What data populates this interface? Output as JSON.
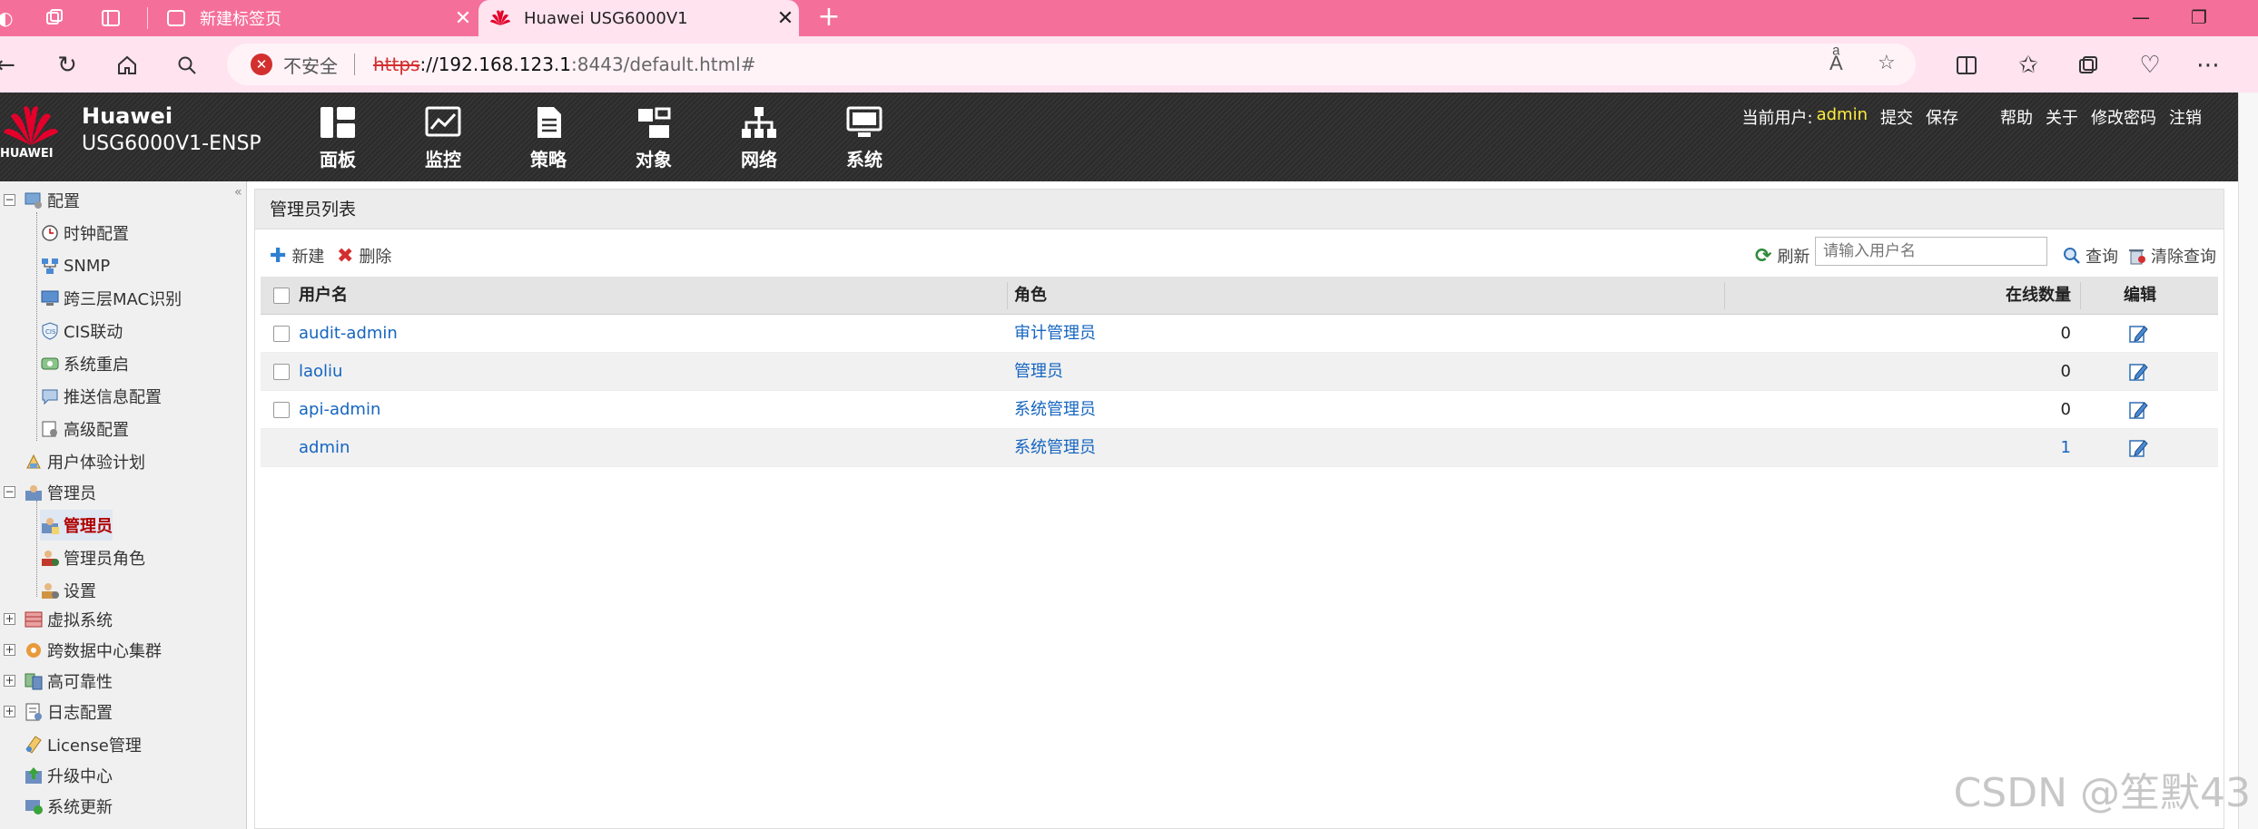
{
  "browser": {
    "tabs": [
      {
        "title": "新建标签页",
        "active": false
      },
      {
        "title": "Huawei USG6000V1",
        "active": true
      }
    ],
    "address": {
      "security_label": "不安全",
      "protocol": "https",
      "host": "://192.168.123.1",
      "rest": ":8443/default.html#"
    }
  },
  "app": {
    "logo_text": "HUAWEI",
    "brand": "Huawei",
    "device": "USG6000V1-ENSP",
    "nav": [
      {
        "label": "面板",
        "icon": "dashboard-icon"
      },
      {
        "label": "监控",
        "icon": "monitor-icon"
      },
      {
        "label": "策略",
        "icon": "policy-icon"
      },
      {
        "label": "对象",
        "icon": "object-icon"
      },
      {
        "label": "网络",
        "icon": "network-icon"
      },
      {
        "label": "系统",
        "icon": "system-icon"
      }
    ],
    "user_label": "当前用户:",
    "user_name": "admin",
    "actions": [
      "提交",
      "保存",
      "帮助",
      "关于",
      "修改密码",
      "注销"
    ]
  },
  "tree": {
    "items": [
      {
        "label": "配置",
        "level": 0,
        "expander": "−"
      },
      {
        "label": "时钟配置",
        "level": 1
      },
      {
        "label": "SNMP",
        "level": 1
      },
      {
        "label": "跨三层MAC识别",
        "level": 1
      },
      {
        "label": "CIS联动",
        "level": 1
      },
      {
        "label": "系统重启",
        "level": 1
      },
      {
        "label": "推送信息配置",
        "level": 1
      },
      {
        "label": "高级配置",
        "level": 1
      },
      {
        "label": "用户体验计划",
        "level": 0
      },
      {
        "label": "管理员",
        "level": 0,
        "expander": "−"
      },
      {
        "label": "管理员",
        "level": 1,
        "active": true
      },
      {
        "label": "管理员角色",
        "level": 1
      },
      {
        "label": "设置",
        "level": 1
      },
      {
        "label": "虚拟系统",
        "level": 0,
        "expander": "+"
      },
      {
        "label": "跨数据中心集群",
        "level": 0,
        "expander": "+"
      },
      {
        "label": "高可靠性",
        "level": 0,
        "expander": "+"
      },
      {
        "label": "日志配置",
        "level": 0,
        "expander": "+"
      },
      {
        "label": "License管理",
        "level": 0
      },
      {
        "label": "升级中心",
        "level": 0
      },
      {
        "label": "系统更新",
        "level": 0
      }
    ]
  },
  "panel": {
    "title": "管理员列表",
    "new_label": "新建",
    "delete_label": "删除",
    "refresh_label": "刷新",
    "search_placeholder": "请输入用户名",
    "query_label": "查询",
    "clear_query_label": "清除查询",
    "columns": {
      "username": "用户名",
      "role": "角色",
      "online": "在线数量",
      "edit": "编辑"
    },
    "rows": [
      {
        "username": "audit-admin",
        "role": "审计管理员",
        "online": "0",
        "checkbox": true
      },
      {
        "username": "laoliu",
        "role": "管理员",
        "online": "0",
        "checkbox": true
      },
      {
        "username": "api-admin",
        "role": "系统管理员",
        "online": "0",
        "checkbox": true
      },
      {
        "username": "admin",
        "role": "系统管理员",
        "online": "1",
        "checkbox": false
      }
    ]
  },
  "watermark": "CSDN @笙默43",
  "colors": {
    "tab_strip": "#f56f9b",
    "toolbar": "#ffe3ef",
    "link": "#1565c0",
    "active_tree": "#b00000",
    "username_highlight": "#ffec3d"
  }
}
